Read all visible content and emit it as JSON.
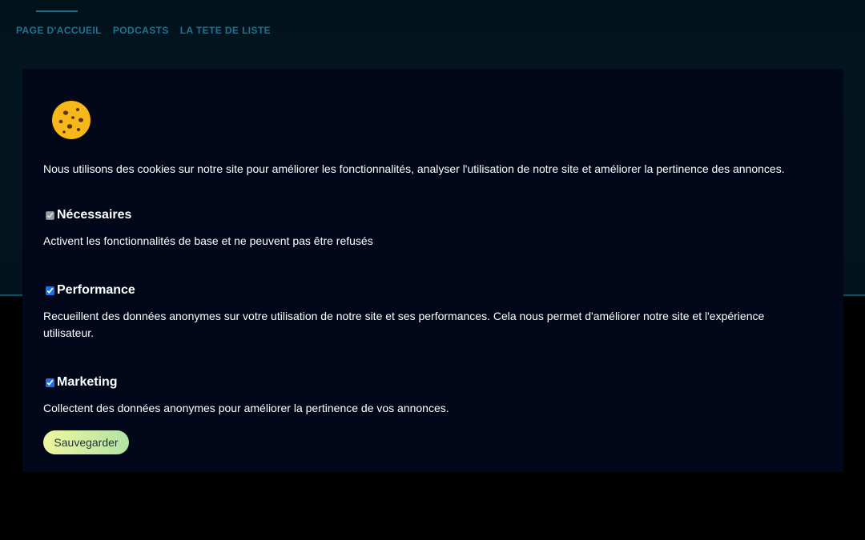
{
  "nav": {
    "links": [
      "PAGE D'ACCUEIL",
      "PODCASTS",
      "LA TETE DE LISTE"
    ]
  },
  "cookie_banner": {
    "icon": "cookie-icon",
    "intro": "Nous utilisons des cookies sur notre site pour améliorer les fonctionnalités, analyser l'utilisation de notre site et améliorer la pertinence des annonces.",
    "categories": [
      {
        "title": "Nécessaires",
        "checked": true,
        "disabled": true,
        "description": "Activent les fonctionnalités de base et ne peuvent pas être refusés"
      },
      {
        "title": "Performance",
        "checked": true,
        "disabled": false,
        "description": "Recueillent des données anonymes sur votre utilisation de notre site et ses performances. Cela nous permet d'améliorer notre site et l'expérience utilisateur."
      },
      {
        "title": "Marketing",
        "checked": true,
        "disabled": false,
        "description": "Collectent des données anonymes pour améliorer la pertinence de vos annonces."
      }
    ],
    "save_label": "Sauvegarder"
  },
  "colors": {
    "nav_link": "#1e7392",
    "panel_bg": "#020819",
    "cookie": "#f5b71a",
    "button_gradient_start": "#eef5a0",
    "button_gradient_end": "#b3e3a3"
  }
}
